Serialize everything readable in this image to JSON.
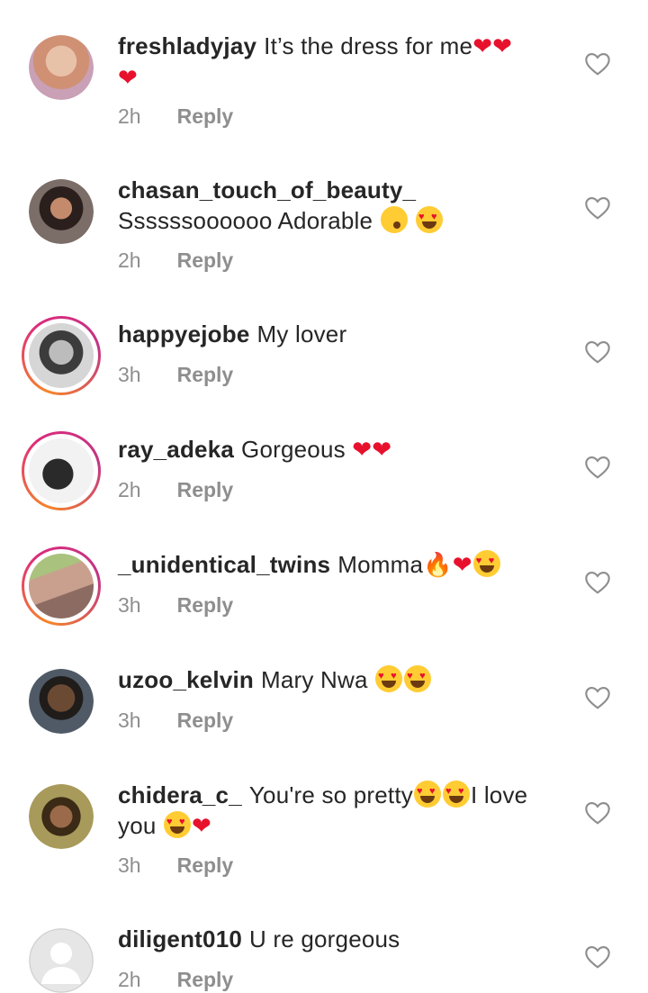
{
  "comments": [
    {
      "username": "freshladyjay",
      "text": "It’s the dress for me",
      "emoji": [
        "heart",
        "heart",
        "heart"
      ],
      "time": "2h",
      "reply": "Reply",
      "avatar_color": "#d9a58a",
      "story": false
    },
    {
      "username": "chasan_touch_of_beauty_",
      "text": "Ssssssoooooo Adorable",
      "emoji": [
        "kiss-face",
        "heart-eyes"
      ],
      "time": "2h",
      "reply": "Reply",
      "avatar_color": "#4a3a36",
      "story": false
    },
    {
      "username": "happyejobe",
      "text": "My lover",
      "emoji": [],
      "time": "3h",
      "reply": "Reply",
      "avatar_color": "#9a9a9a",
      "story": true
    },
    {
      "username": "ray_adeka",
      "text": "Gorgeous",
      "emoji": [
        "heart",
        "heart"
      ],
      "time": "2h",
      "reply": "Reply",
      "avatar_color": "#6e6e6e",
      "story": true
    },
    {
      "username": "_unidentical_twins",
      "text": "Momma",
      "emoji": [
        "fire",
        "heart",
        "heart-eyes"
      ],
      "time": "3h",
      "reply": "Reply",
      "avatar_color": "#b88a78",
      "story": true
    },
    {
      "username": "uzoo_kelvin",
      "text": "Mary Nwa",
      "emoji": [
        "heart-eyes",
        "heart-eyes"
      ],
      "time": "3h",
      "reply": "Reply",
      "avatar_color": "#3b3632",
      "story": false
    },
    {
      "username": "chidera_c_",
      "text": "You're so pretty",
      "emoji": [
        "heart-eyes",
        "heart-eyes"
      ],
      "text2": "I love you",
      "emoji2": [
        "heart-eyes",
        "heart"
      ],
      "time": "3h",
      "reply": "Reply",
      "avatar_color": "#8b7a3c",
      "story": false
    },
    {
      "username": "diligent010",
      "text": "U re gorgeous",
      "emoji": [],
      "time": "2h",
      "reply": "Reply",
      "avatar_color": "#e3e3e3",
      "story": false
    }
  ],
  "colors": {
    "username": "#262626",
    "meta": "#8e8e8e",
    "heart_outline": "#8e8e8e",
    "emoji_heart": "#e8112d"
  }
}
